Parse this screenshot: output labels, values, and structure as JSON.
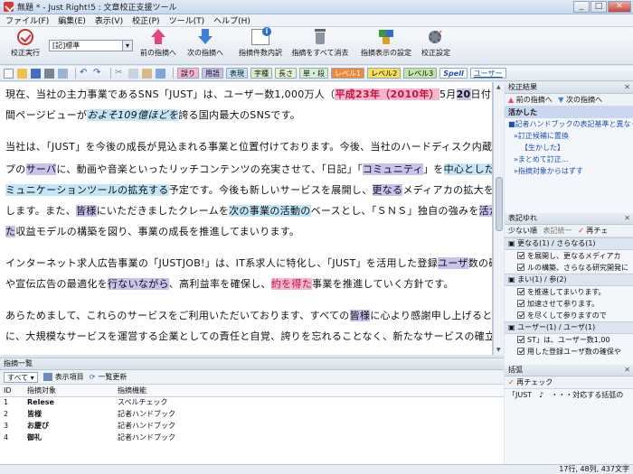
{
  "window": {
    "title": "無題 * - Just Right!5 : 文章校正支援ツール",
    "controls": [
      "_",
      "□",
      "✕"
    ]
  },
  "menu": [
    "ファイル(F)",
    "編集(E)",
    "表示(V)",
    "校正(P)",
    "ツール(T)",
    "ヘルプ(H)"
  ],
  "toolbar": {
    "check": "校正実行",
    "combo": "[記]標準",
    "prev": "前の指摘へ",
    "next": "次の指摘へ",
    "count": "指摘件数内訳",
    "clear": "指摘をすべて消去",
    "display": "指摘表示の設定",
    "settings": "校正設定"
  },
  "tags": [
    "誤り",
    "用語",
    "表現",
    "字種",
    "長さ",
    "単・段",
    "レベル1",
    "レベル2",
    "レベル3",
    "Spell",
    "ユーザー"
  ],
  "editor": {
    "l1a": "現在、当社の主力事業であるSNS「JUST」は、ユーザー数1,000万人（",
    "l1b": "平成23年（2010年）",
    "l1c": "5月",
    "l1d": "20",
    "l1e": "日付）、月",
    "l2a": "間ページビューが",
    "l2b": "およそ109億ほどを",
    "l2c": "誇る国内最大のSNSです。",
    "l3a": "当社は、「JUST」を今後の成長が見込まれる事業と位置付けております。今後、当社のハードディスク内蔵タイ",
    "l4a": "プの",
    "l4b": "サーバ",
    "l4c": "に、動画や音楽といったリッチコンテンツの充実させて、「日記」「",
    "l4d": "コミュニティ",
    "l4e": "」を",
    "l4f": "中心としたコ",
    "l5a": "ミュニケーションツールの拡充する",
    "l5b": "予定です。今後も新しいサービスを展開し、",
    "l5c": "更なる",
    "l5d": "メディアカの拡大を目指",
    "l6a": "します。また、",
    "l6b": "皆様",
    "l6c": "にいただきましたクレームを",
    "l6d": "次の事業の活動の",
    "l6e": "ベースとし、「ＳＮＳ」独自の強みを",
    "l6f": "活かし",
    "l7a": "た",
    "l7b": "収益モデルの構築を図り、事業の成長を推進してまいります。",
    "l8a": "インターネット求人広告事業の「JUSTJOB!」は、IT系求人に特化し、「JUST」を活用した登録",
    "l8b": "ユーザ",
    "l8c": "数の確保",
    "l9a": "や宣伝広告の最適化を",
    "l9b": "行ないながら",
    "l9c": "、高利益率を確保し、",
    "l9d": "約を得た",
    "l9e": "事業を推進していく方針です。",
    "l10a": "あらためまして、これらのサービスをご利用いただいております、すべての",
    "l10b": "皆様",
    "l10c": "に心より感謝申し上げるととも",
    "l11a": "に、大規模なサービスを運営する企業としての責任と自覚、誇りを忘れることなく、新たなサービスの確立や収"
  },
  "results": {
    "title": "校正結果",
    "prev": "前の指摘へ",
    "next": "次の指摘へ",
    "selected": "活かした",
    "items": [
      "■記者ハンドブックの表記基準と異なっ",
      "»訂正候補に置換",
      "【生かした】",
      "»まとめて訂正...",
      "»指摘対象からはずす"
    ]
  },
  "variation": {
    "title": "表記ゆれ",
    "sort": "少ない順",
    "unify": "表記統一",
    "recheck": "再チェ",
    "groups": [
      {
        "head": "更なる(1) / さらなる(1)",
        "rows": [
          "を展開し、更なるメディアカ",
          "ルの構築、さらなる研究開発に"
        ]
      },
      {
        "head": "まい(1) / 参(2)",
        "rows": [
          "を推進してまいります。",
          "加速させて参ります。",
          "を尽くして参りますので"
        ]
      },
      {
        "head": "ユーザー(1) / ユーザ(1)",
        "rows": [
          "ST」は、ユーザー数1,00",
          "用した登録ユーザ数の確保や"
        ]
      }
    ]
  },
  "brackets": {
    "title": "括弧",
    "recheck": "再チェック",
    "row": "「JUST　♪　・・・対応する括弧の"
  },
  "list": {
    "title": "指摘一覧",
    "filter": "すべて",
    "items": "表示項目",
    "refresh": "一覧更新",
    "headers": [
      "ID",
      "指摘対象",
      "指摘機能"
    ],
    "rows": [
      [
        "1",
        "Relese",
        "スペルチェック"
      ],
      [
        "2",
        "皆様",
        "記者ハンドブック"
      ],
      [
        "3",
        "お慶び",
        "記者ハンドブック"
      ],
      [
        "4",
        "御礼",
        "記者ハンドブック"
      ]
    ]
  },
  "status": "17行, 48列, 437文字"
}
